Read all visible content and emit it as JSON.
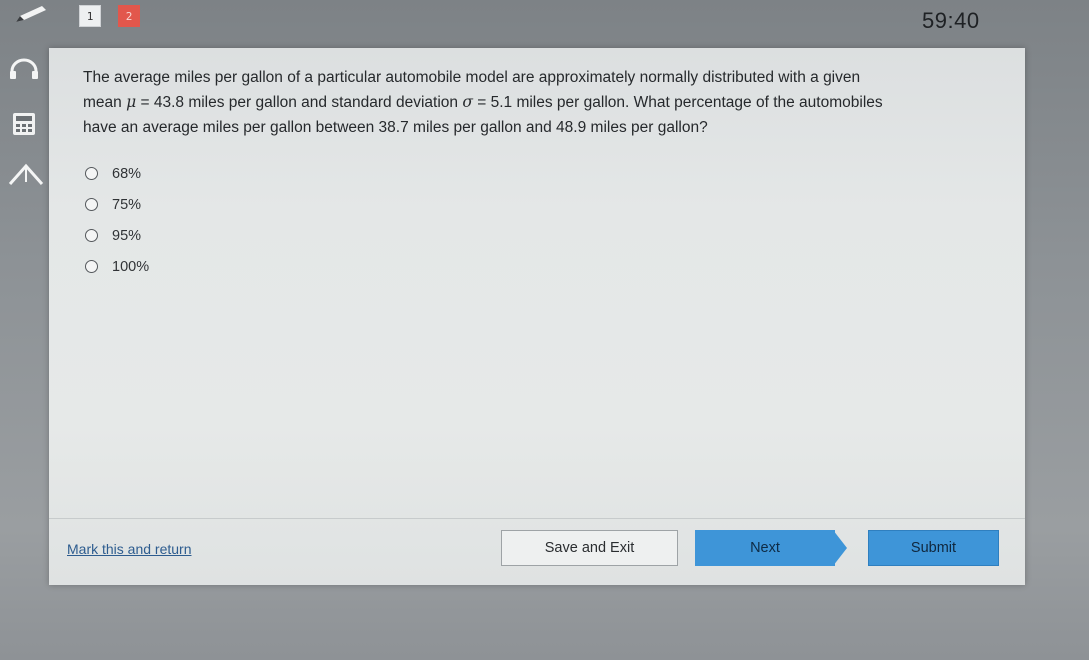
{
  "topbar": {
    "questions": [
      {
        "label": "1",
        "state": "visited"
      },
      {
        "label": "2",
        "state": "current"
      }
    ],
    "timer": "59:40"
  },
  "tools": {
    "icons": [
      "headphones-icon",
      "calculator-icon",
      "arrow-up-icon",
      "pencil-icon"
    ]
  },
  "question": {
    "line1": "The average miles per gallon of a particular automobile model are approximately normally distributed with a given",
    "line2_a": "mean ",
    "mu_symbol": "μ",
    "mu_value": " = 43.8",
    "line2_b": " miles per gallon and standard deviation ",
    "sigma_symbol": "σ",
    "sigma_value": " = 5.1",
    "line2_c": " miles per gallon. What percentage of the automobiles",
    "line3": "have an average miles per gallon between 38.7 miles per gallon and 48.9 miles per gallon?"
  },
  "options": [
    {
      "label": "68%"
    },
    {
      "label": "75%"
    },
    {
      "label": "95%"
    },
    {
      "label": "100%"
    }
  ],
  "footer": {
    "mark_label": "Mark this and return",
    "save_label": "Save and Exit",
    "next_label": "Next",
    "submit_label": "Submit"
  },
  "colors": {
    "accent": "#3e95d8",
    "current_question": "#e2574c"
  }
}
